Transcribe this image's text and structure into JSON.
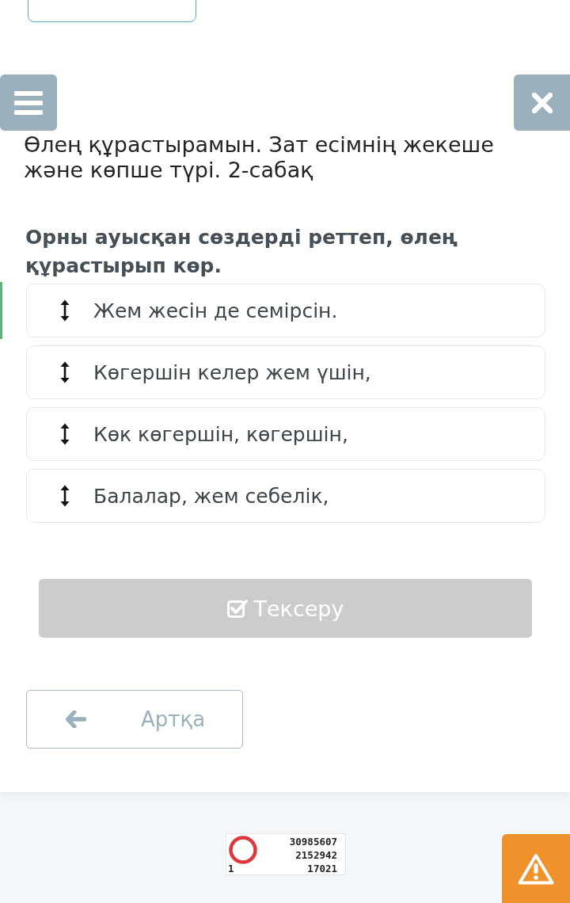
{
  "lesson": {
    "title": "Өлең құрастырамын. Зат есімнің жекеше және көпше түрі. 2-сабақ"
  },
  "question": {
    "prompt": "Орны ауысқан сөздерді реттеп, өлең құрастырып көр.",
    "items": [
      {
        "text": "Жем жесін де семірсін."
      },
      {
        "text": "Көгершін келер жем үшін,"
      },
      {
        "text": "Көк көгершін, көгершін,"
      },
      {
        "text": "Балалар, жем себелік,"
      }
    ]
  },
  "actions": {
    "check_button": {
      "label": "Тексеру",
      "disabled": true
    },
    "back_button": {
      "label": "Артқа"
    }
  },
  "counter": {
    "lines": [
      "30985607",
      "2152942"
    ],
    "left_value": "1",
    "right_value": "17021"
  }
}
